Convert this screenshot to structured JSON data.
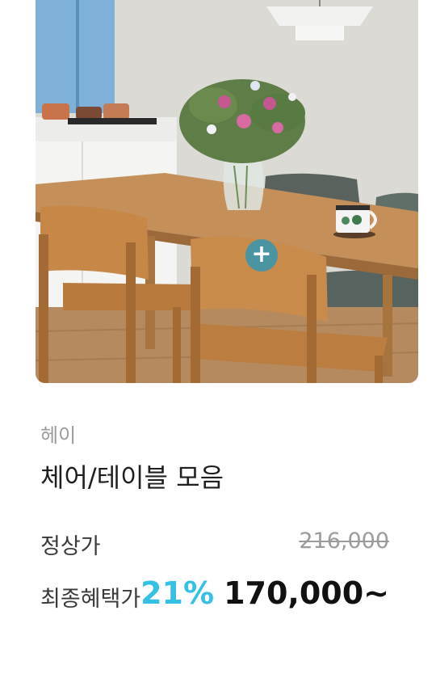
{
  "product": {
    "image_alt": "dining table with wooden chairs",
    "add_button_symbol": "+",
    "brand": "헤이",
    "title": "체어/테이블 모음",
    "regular_price_label": "정상가",
    "regular_price": "216,000",
    "final_price_label": "최종혜택가",
    "discount": "21%",
    "final_price": "170,000~"
  },
  "colors": {
    "accent": "#35c0e6",
    "plus_button": "#3596b2",
    "text_dark": "#111111",
    "text_muted": "#9b9b9b"
  }
}
